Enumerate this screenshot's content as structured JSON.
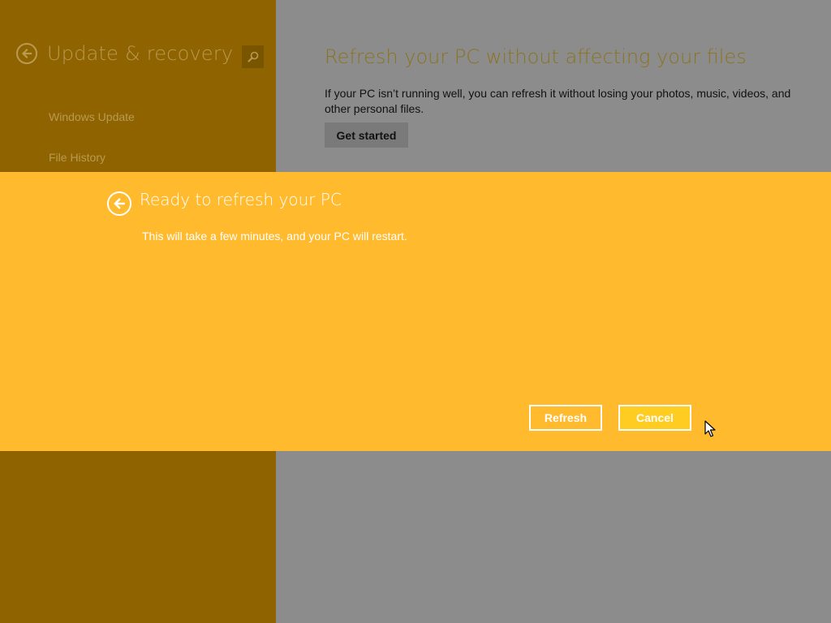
{
  "colors": {
    "sidebar_bg": "#8f6300",
    "sidebar_text": "#b89a52",
    "sidebar_title": "#b89a52",
    "search_bg": "#7a5500",
    "main_bg": "#8c8c8c",
    "main_title": "#8a7420",
    "main_text": "#111111",
    "get_started_bg": "#7a7a7a",
    "modal_bg": "#ffba2e",
    "modal_text": "#ffffff",
    "cancel_bg": "#ffcc22"
  },
  "sidebar": {
    "title": "Update & recovery",
    "back_icon": "back-arrow-icon",
    "search_icon": "search-icon",
    "items": [
      {
        "label": "Windows Update"
      },
      {
        "label": "File History"
      }
    ]
  },
  "main": {
    "title": "Refresh your PC without affecting your files",
    "description": "If your PC isn’t running well, you can refresh it without losing your photos, music, videos, and other personal files.",
    "get_started_label": "Get started"
  },
  "dialog": {
    "back_icon": "back-arrow-icon",
    "title": "Ready to refresh your PC",
    "description": "This will take a few minutes, and your PC will restart.",
    "refresh_label": "Refresh",
    "cancel_label": "Cancel"
  }
}
